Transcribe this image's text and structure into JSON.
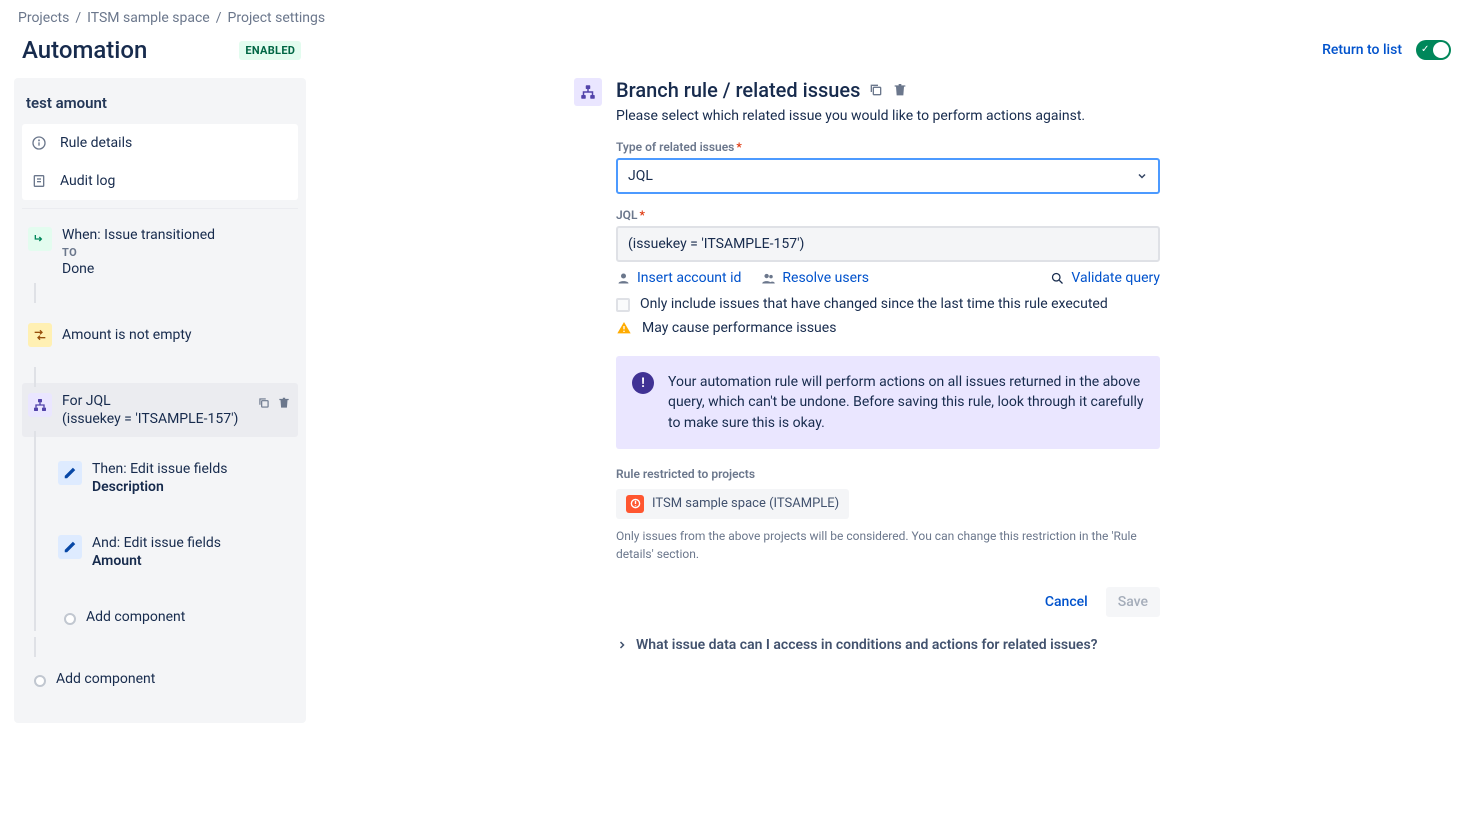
{
  "breadcrumb": [
    "Projects",
    "ITSM sample space",
    "Project settings"
  ],
  "header": {
    "title": "Automation",
    "status_badge": "ENABLED",
    "return_link": "Return to list"
  },
  "rule": {
    "name": "test amount",
    "nav": {
      "details": "Rule details",
      "audit": "Audit log"
    },
    "flow": {
      "trigger": {
        "line1": "When: Issue transitioned",
        "sub": "TO",
        "line2": "Done"
      },
      "condition": {
        "line1": "Amount is not empty"
      },
      "branch": {
        "line1": "For JQL",
        "line2": "(issuekey = 'ITSAMPLE-157')"
      },
      "action1": {
        "line1": "Then: Edit issue fields",
        "line2": "Description"
      },
      "action2": {
        "line1": "And: Edit issue fields",
        "line2": "Amount"
      },
      "add_component_inner": "Add component",
      "add_component_outer": "Add component"
    }
  },
  "detail": {
    "title": "Branch rule / related issues",
    "desc": "Please select which related issue you would like to perform actions against.",
    "type_label": "Type of related issues",
    "type_value": "JQL",
    "jql_label": "JQL",
    "jql_value": "(issuekey = 'ITSAMPLE-157')",
    "links": {
      "insert_account": "Insert account id",
      "resolve_users": "Resolve users",
      "validate_query": "Validate query"
    },
    "only_changed": "Only include issues that have changed since the last time this rule executed",
    "perf_warning": "May cause performance issues",
    "info": "Your automation rule will perform actions on all issues returned in the above query, which can't be undone. Before saving this rule, look through it carefully to make sure this is okay.",
    "restricted_label": "Rule restricted to projects",
    "project_chip": "ITSM sample space (ITSAMPLE)",
    "restricted_helper": "Only issues from the above projects will be considered. You can change this restriction in the 'Rule details' section.",
    "cancel": "Cancel",
    "save": "Save",
    "expand": "What issue data can I access in conditions and actions for related issues?"
  }
}
